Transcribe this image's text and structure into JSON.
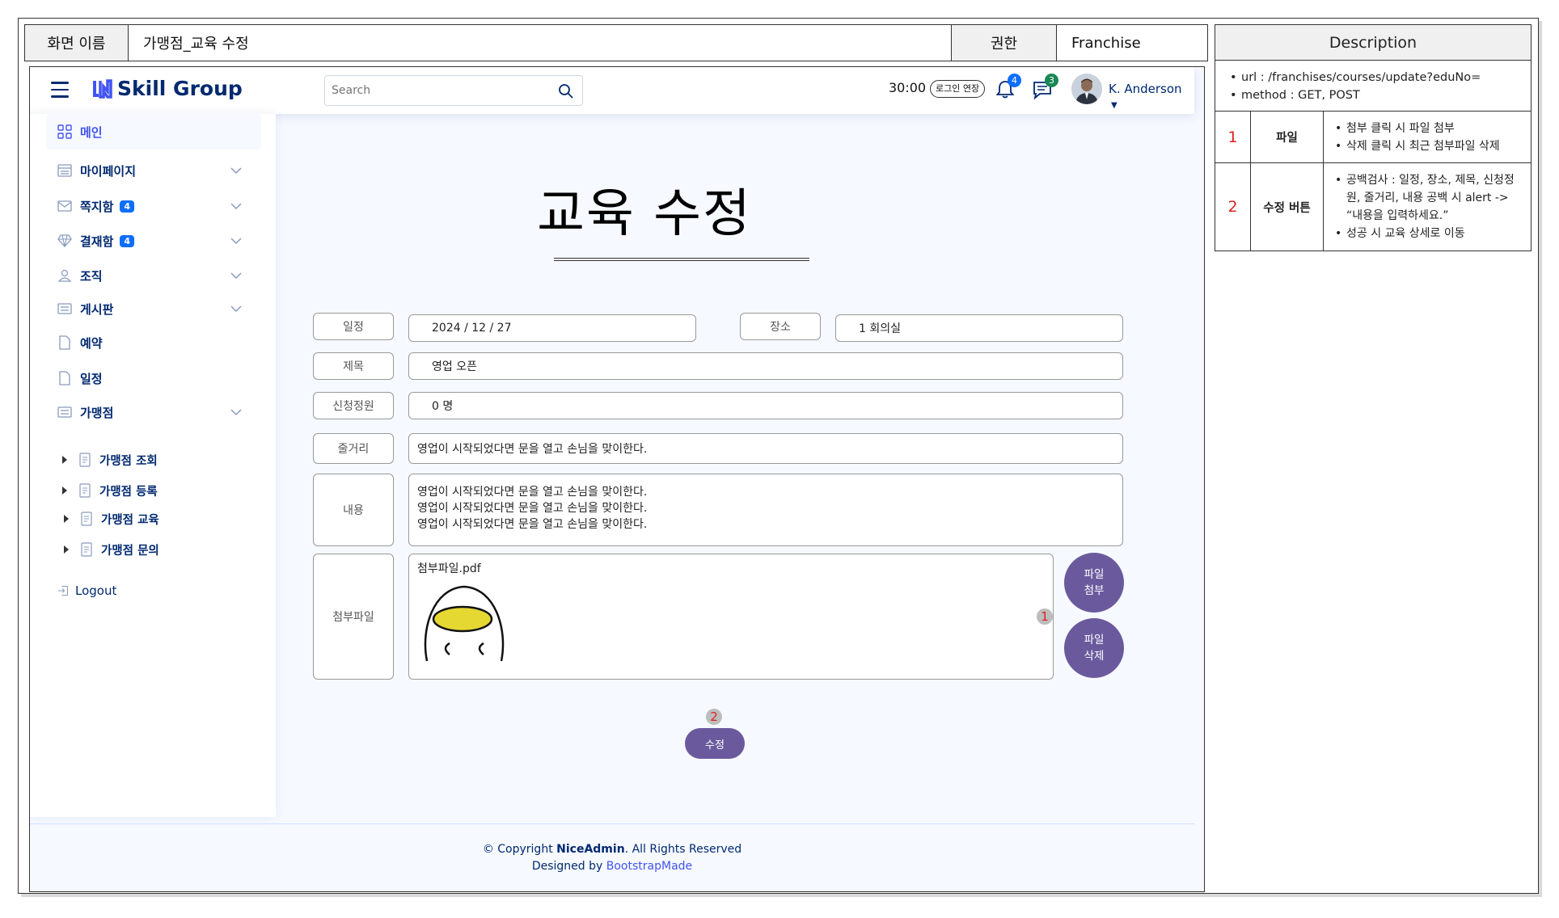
{
  "header": {
    "screen_name_label": "화면 이름",
    "screen_name": "가맹점_교육 수정",
    "permission_label": "권한",
    "permission": "Franchise"
  },
  "description": {
    "title": "Description",
    "meta": [
      "url :  /franchises/courses/update?eduNo=",
      "method : GET, POST"
    ],
    "rows": [
      {
        "num": "1",
        "label": "파일",
        "items": [
          "첨부 클릭 시 파일 첨부",
          "삭제 클릭 시 최근 첨부파일 삭제"
        ]
      },
      {
        "num": "2",
        "label": "수정 버튼",
        "items": [
          "공백검사 : 일정, 장소, 제목, 신청정원, 줄거리, 내용 공백 시 alert -> “내용을 입력하세요.”",
          "성공 시 교육 상세로 이동"
        ]
      }
    ]
  },
  "topbar": {
    "brand": "Skill Group",
    "search_placeholder": "Search",
    "timer": "30:00",
    "extend_label": "로그인 연장",
    "notif_count": "4",
    "message_count": "3",
    "user_name": "K. Anderson",
    "brand_color": "#012970",
    "notif_badge_color": "#0d6efd",
    "message_badge_color": "#198754"
  },
  "sidebar": {
    "items": [
      {
        "label": "메인",
        "icon": "grid-icon"
      },
      {
        "label": "마이페이지",
        "icon": "menu-icon"
      },
      {
        "label": "쪽지함",
        "icon": "envelope-icon",
        "badge": "4"
      },
      {
        "label": "결재함",
        "icon": "gem-icon",
        "badge": "4"
      },
      {
        "label": "조직",
        "icon": "person-icon"
      },
      {
        "label": "게시판",
        "icon": "layout-icon"
      },
      {
        "label": "예약",
        "icon": "file-icon"
      },
      {
        "label": "일정",
        "icon": "file-icon"
      },
      {
        "label": "가맹점",
        "icon": "layout-icon"
      }
    ],
    "sub_items": [
      "가맹점 조회",
      "가맹점 등록",
      "가맹점 교육",
      "가맹점 문의"
    ],
    "logout": "Logout"
  },
  "form": {
    "title": "교육 수정",
    "schedule_label": "일정",
    "schedule_value": "2024 / 12 / 27",
    "place_label": "장소",
    "place_value": "1 회의실",
    "subject_label": "제목",
    "subject_value": "영업 오픈",
    "capacity_label": "신청정원",
    "capacity_value": "0 명",
    "summary_label": "줄거리",
    "summary_value": "영업이 시작되었다면 문을 열고 손님을 맞이한다.",
    "content_label": "내용",
    "content_lines": [
      "영업이 시작되었다면 문을 열고 손님을 맞이한다.",
      "영업이 시작되었다면 문을 열고 손님을 맞이한다.",
      "영업이 시작되었다면 문을 열고 손님을 맞이한다."
    ],
    "attach_label": "첨부파일",
    "attach_filename": "첨부파일.pdf",
    "attach_button": [
      "파일",
      "첨부"
    ],
    "delete_button": [
      "파일",
      "삭제"
    ],
    "submit_label": "수정",
    "marker_1": "1",
    "marker_2": "2",
    "button_color": "#6a5a9d"
  },
  "footer": {
    "copyright_prefix": "© Copyright ",
    "copyright_brand": "NiceAdmin",
    "copyright_suffix": ". All Rights Reserved",
    "designed_prefix": "Designed by ",
    "designed_link": "BootstrapMade"
  }
}
